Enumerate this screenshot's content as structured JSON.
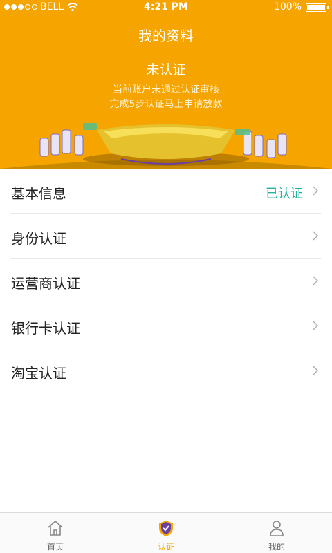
{
  "status_bar": {
    "carrier": "BELL",
    "time": "4:21 PM",
    "battery": "100%"
  },
  "header": {
    "title": "我的资料",
    "status": "未认证",
    "line1": "当前账户未通过认证审核",
    "line2": "完成5步认证马上申请放款"
  },
  "items": [
    {
      "label": "基本信息",
      "badge": "已认证"
    },
    {
      "label": "身份认证"
    },
    {
      "label": "运营商认证"
    },
    {
      "label": "银行卡认证"
    },
    {
      "label": "淘宝认证"
    }
  ],
  "tabs": [
    {
      "label": "首页",
      "icon": "home-icon"
    },
    {
      "label": "认证",
      "icon": "shield-check-icon",
      "active": true
    },
    {
      "label": "我的",
      "icon": "user-icon"
    }
  ],
  "colors": {
    "accent": "#f5a400",
    "verified": "#22b39a"
  }
}
